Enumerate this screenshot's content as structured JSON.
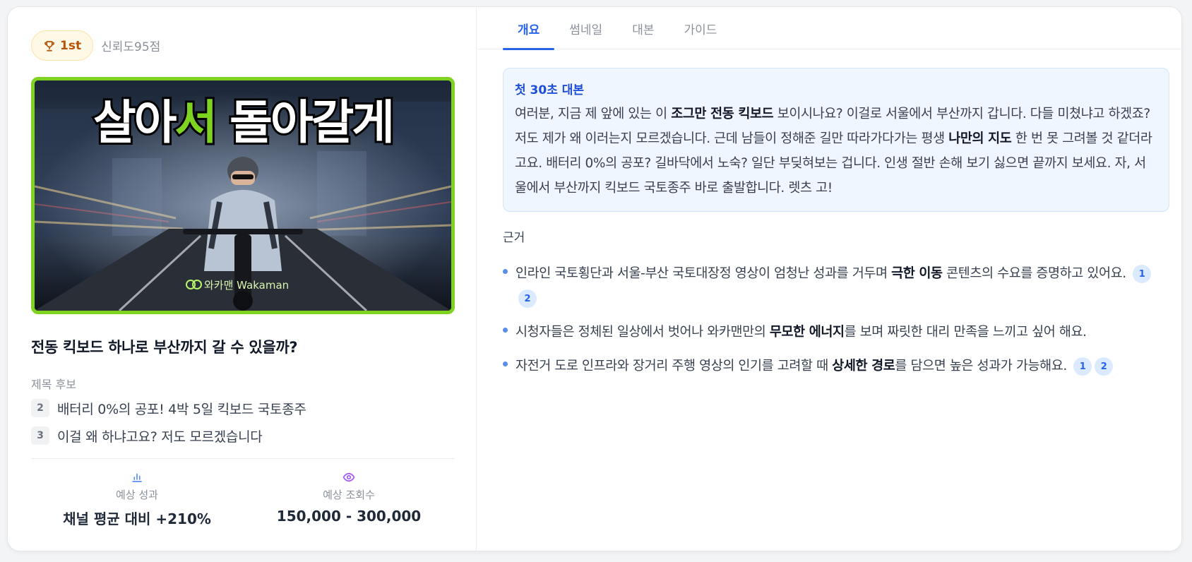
{
  "rank": {
    "badge_label": "1st",
    "badge_icon": "trophy-icon",
    "trust_text": "신뢰도95점"
  },
  "thumbnail": {
    "headline_part1": "살아",
    "headline_highlight": "서",
    "headline_part2": " 돌아갈게",
    "watermark": "와카맨 Wakaman",
    "border_color": "#7ed321",
    "highlight_color": "#7ed321"
  },
  "video_title": "전동 킥보드 하나로 부산까지 갈 수 있을까?",
  "title_candidates": {
    "label": "제목 후보",
    "items": [
      {
        "num": "2",
        "text": "배터리 0%의 공포! 4박 5일 킥보드 국토종주"
      },
      {
        "num": "3",
        "text": "이걸 왜 하냐고요? 저도 모르겠습니다"
      }
    ]
  },
  "metrics": [
    {
      "icon": "bar-chart-icon",
      "label": "예상 성과",
      "value": "채널 평균 대비 +210%"
    },
    {
      "icon": "eye-icon",
      "label": "예상 조회수",
      "value": "150,000 - 300,000"
    }
  ],
  "tabs": [
    {
      "label": "개요",
      "active": true
    },
    {
      "label": "썸네일",
      "active": false
    },
    {
      "label": "대본",
      "active": false
    },
    {
      "label": "가이드",
      "active": false
    }
  ],
  "script": {
    "title": "첫 30초 대본",
    "segments": [
      {
        "text": "여러분, 지금 제 앞에 있는 이 ",
        "bold": false
      },
      {
        "text": "조그만 전동 킥보드",
        "bold": true
      },
      {
        "text": " 보이시나요? 이걸로 서울에서 부산까지 갑니다. 다들 미쳤냐고 하겠죠? 저도 제가 왜 이러는지 모르겠습니다. 근데 남들이 정해준 길만 따라가다가는 평생 ",
        "bold": false
      },
      {
        "text": "나만의 지도",
        "bold": true
      },
      {
        "text": " 한 번 못 그려볼 것 같더라고요. 배터리 0%의 공포? 길바닥에서 노숙? 일단 부딪혀보는 겁니다. 인생 절반 손해 보기 싫으면 끝까지 보세요. 자, 서울에서 부산까지 킥보드 국토종주 바로 출발합니다. 렛츠 고!",
        "bold": false
      }
    ]
  },
  "evidence": {
    "label": "근거",
    "items": [
      {
        "segments": [
          {
            "text": "인라인 국토횡단과 서울-부산 국토대장정 영상이 엄청난 성과를 거두며 ",
            "bold": false
          },
          {
            "text": "극한 이동",
            "bold": true
          },
          {
            "text": " 콘텐츠의 수요를 증명하고 있어요.",
            "bold": false
          }
        ],
        "citations": [
          "1",
          "2"
        ]
      },
      {
        "segments": [
          {
            "text": "시청자들은 정체된 일상에서 벗어나 와카맨만의 ",
            "bold": false
          },
          {
            "text": "무모한 에너지",
            "bold": true
          },
          {
            "text": "를 보며 짜릿한 대리 만족을 느끼고 싶어 해요.",
            "bold": false
          }
        ],
        "citations": []
      },
      {
        "segments": [
          {
            "text": "자전거 도로 인프라와 장거리 주행 영상의 인기를 고려할 때 ",
            "bold": false
          },
          {
            "text": "상세한 경로",
            "bold": true
          },
          {
            "text": "를 담으면 높은 성과가 가능해요.",
            "bold": false
          }
        ],
        "citations": [
          "1",
          "2"
        ]
      }
    ]
  },
  "colors": {
    "accent": "#2563eb",
    "badge_bg": "#fef9e7",
    "script_bg": "#eff6ff"
  }
}
